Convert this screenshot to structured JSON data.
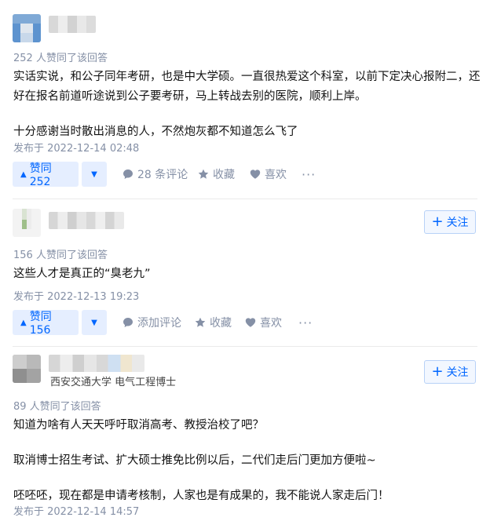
{
  "follow_label": "关注",
  "answers": [
    {
      "votes_meta": "252 人赞同了该回答",
      "paragraphs": [
        "实话实说，和公子同年考研，也是中大学硕。一直很热爱这个科室，以前下定决心报附二，还好在报名前道听途说到公子要考研，马上转战去别的医院，顺利上岸。",
        "十分感谢当时散出消息的人，不然炮灰都不知道怎么飞了"
      ],
      "time": "发布于 2022-12-14 02:48",
      "vote_label": "赞同 252",
      "comment_label": "28 条评论",
      "collect_label": "收藏",
      "like_label": "喜欢"
    },
    {
      "votes_meta": "156 人赞同了该回答",
      "paragraphs": [
        "这些人才是真正的“臭老九”"
      ],
      "time": "发布于 2022-12-13 19:23",
      "vote_label": "赞同 156",
      "comment_label": "添加评论",
      "collect_label": "收藏",
      "like_label": "喜欢"
    },
    {
      "headline": "西安交通大学 电气工程博士",
      "votes_meta": "89 人赞同了该回答",
      "paragraphs": [
        "知道为啥有人天天呼吁取消高考、教授治校了吧？",
        "取消博士招生考试、扩大硕士推免比例以后，二代们走后门更加方便啦~",
        "呸呸呸，现在都是申请考核制，人家也是有成果的，我不能说人家走后门！"
      ],
      "time": "发布于 2022-12-14 14:57"
    }
  ],
  "icons": {
    "vote_up": "triangle-up-icon",
    "vote_down": "triangle-down-icon",
    "comment": "speech-bubble-icon",
    "collect": "star-icon",
    "like": "heart-icon",
    "more": "ellipsis-icon",
    "follow": "plus-icon"
  },
  "colors": {
    "accent": "#0066ff",
    "vote_bg": "#e5eeff",
    "meta": "#8590a6",
    "text": "#121212"
  }
}
